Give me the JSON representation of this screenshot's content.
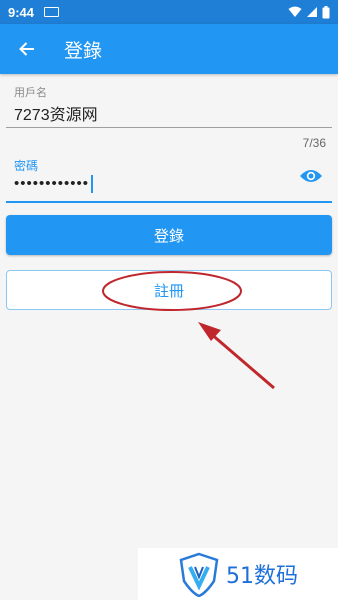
{
  "status_bar": {
    "time": "9:44"
  },
  "app_bar": {
    "title": "登錄"
  },
  "form": {
    "username_label": "用戶名",
    "username_value": "7273资源网",
    "counter": "7/36",
    "password_label": "密碼",
    "password_value": "••••••••••••"
  },
  "buttons": {
    "login": "登錄",
    "register": "註冊"
  },
  "watermark": {
    "logo_text": "51数码"
  },
  "colors": {
    "primary": "#2196f3",
    "status_bar": "#1f7fd6",
    "annotation": "#c0272d"
  },
  "icons": [
    "back-arrow-icon",
    "eye-icon",
    "wifi-icon",
    "signal-icon",
    "battery-icon",
    "keyboard-icon"
  ]
}
